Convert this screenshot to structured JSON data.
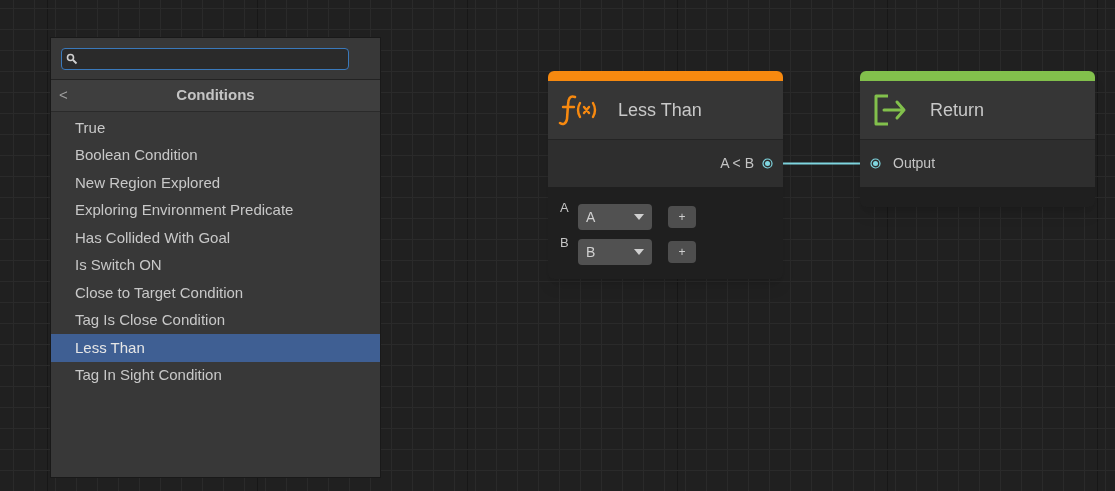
{
  "menu": {
    "title": "Conditions",
    "back": "<",
    "items": [
      {
        "label": "True",
        "selected": false
      },
      {
        "label": "Boolean Condition",
        "selected": false
      },
      {
        "label": "New Region Explored",
        "selected": false
      },
      {
        "label": "Exploring Environment Predicate",
        "selected": false
      },
      {
        "label": "Has Collided With Goal",
        "selected": false
      },
      {
        "label": "Is Switch ON",
        "selected": false
      },
      {
        "label": "Close to Target Condition",
        "selected": false
      },
      {
        "label": "Tag Is Close Condition",
        "selected": false
      },
      {
        "label": "Less Than",
        "selected": true
      },
      {
        "label": "Tag In Sight Condition",
        "selected": false
      }
    ]
  },
  "nodes": [
    {
      "kind": "function",
      "title": "Less Than",
      "color": "#f7890f",
      "outputs": [
        "A < B"
      ],
      "inputs": [
        {
          "label": "A",
          "value": "A",
          "add": "+"
        },
        {
          "label": "B",
          "value": "B",
          "add": "+"
        }
      ]
    },
    {
      "kind": "return",
      "title": "Return",
      "color": "#82c04c",
      "input_ports": [
        "Output"
      ]
    }
  ]
}
